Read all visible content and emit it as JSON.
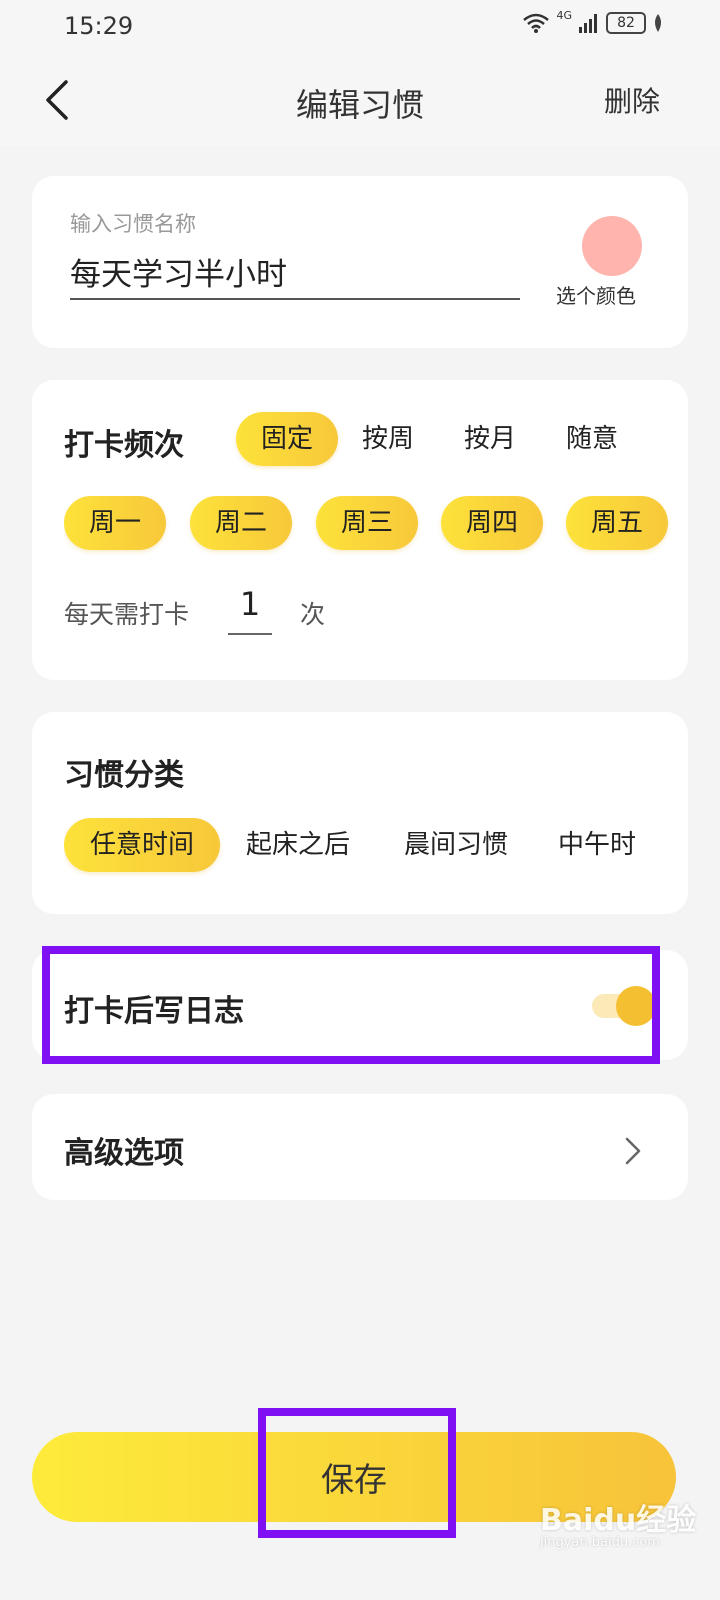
{
  "status_bar": {
    "time": "15:29",
    "network": "4G",
    "battery": "82"
  },
  "nav": {
    "title": "编辑习惯",
    "delete": "删除"
  },
  "habit_name": {
    "label": "输入习惯名称",
    "value": "每天学习半小时",
    "color_label": "选个颜色",
    "color": "#ffb4ad"
  },
  "frequency": {
    "title": "打卡频次",
    "modes": [
      {
        "label": "固定",
        "selected": true
      },
      {
        "label": "按周",
        "selected": false
      },
      {
        "label": "按月",
        "selected": false
      },
      {
        "label": "随意",
        "selected": false
      }
    ],
    "weekdays": [
      {
        "label": "周一",
        "selected": true
      },
      {
        "label": "周二",
        "selected": true
      },
      {
        "label": "周三",
        "selected": true
      },
      {
        "label": "周四",
        "selected": true
      },
      {
        "label": "周五",
        "selected": true
      }
    ],
    "times_label": "每天需打卡",
    "times_value": "1",
    "times_unit": "次"
  },
  "category": {
    "title": "习惯分类",
    "items": [
      {
        "label": "任意时间",
        "selected": true
      },
      {
        "label": "起床之后",
        "selected": false
      },
      {
        "label": "晨间习惯",
        "selected": false
      },
      {
        "label": "中午时",
        "selected": false
      }
    ]
  },
  "journal": {
    "label": "打卡后写日志",
    "enabled": true
  },
  "advanced": {
    "label": "高级选项"
  },
  "save": {
    "label": "保存"
  },
  "watermark": {
    "text": "Baidu经验",
    "sub": "jingyan.baidu.com"
  },
  "colors": {
    "accent": "#f7c83a",
    "highlight": "#7f10f4"
  }
}
